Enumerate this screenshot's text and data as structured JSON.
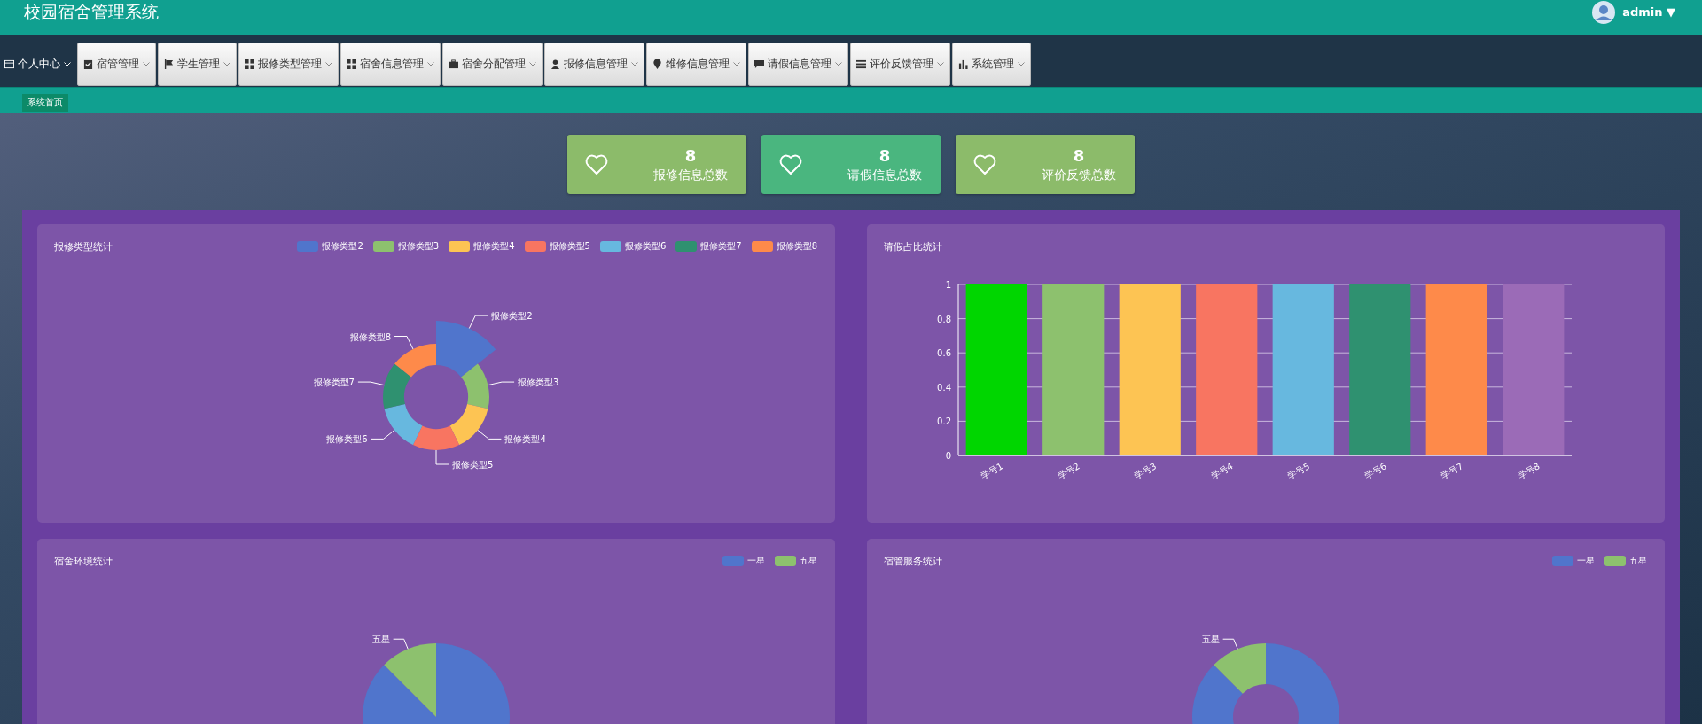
{
  "header": {
    "title": "校园宿舍管理系统",
    "user": "admin",
    "caret": "▼"
  },
  "nav": [
    {
      "label": "个人中心",
      "selected": true
    },
    {
      "label": "宿管管理",
      "selected": false
    },
    {
      "label": "学生管理",
      "selected": false
    },
    {
      "label": "报修类型管理",
      "selected": false
    },
    {
      "label": "宿舍信息管理",
      "selected": false
    },
    {
      "label": "宿舍分配管理",
      "selected": false
    },
    {
      "label": "报修信息管理",
      "selected": false
    },
    {
      "label": "维修信息管理",
      "selected": false
    },
    {
      "label": "请假信息管理",
      "selected": false
    },
    {
      "label": "评价反馈管理",
      "selected": false
    },
    {
      "label": "系统管理",
      "selected": false
    }
  ],
  "tooltip": "系统首页",
  "stats": [
    {
      "value": "8",
      "label": "报修信息总数",
      "color": "#8cbb6a"
    },
    {
      "value": "8",
      "label": "请假信息总数",
      "color": "#4ab67f"
    },
    {
      "value": "8",
      "label": "评价反馈总数",
      "color": "#8cbb6a"
    }
  ],
  "charts": [
    {
      "kind": "rose",
      "title": "报修类型统计",
      "legend": [
        {
          "label": "报修类型2",
          "color": "#5075cc"
        },
        {
          "label": "报修类型3",
          "color": "#8dc16e"
        },
        {
          "label": "报修类型4",
          "color": "#fdc453"
        },
        {
          "label": "报修类型5",
          "color": "#f87561"
        },
        {
          "label": "报修类型6",
          "color": "#67b8df"
        },
        {
          "label": "报修类型7",
          "color": "#2f9170"
        },
        {
          "label": "报修类型8",
          "color": "#fe8a4a"
        }
      ],
      "slice_labels": [
        "报修类型2",
        "报修类型3",
        "报修类型4",
        "报修类型5",
        "报修类型6",
        "报修类型7",
        "报修类型8"
      ]
    },
    {
      "kind": "bar",
      "title": "请假占比统计",
      "chart_data": {
        "type": "bar",
        "categories": [
          "学号1",
          "学号2",
          "学号3",
          "学号4",
          "学号5",
          "学号6",
          "学号7",
          "学号8"
        ],
        "series": [
          {
            "values": [
              1,
              1,
              1,
              1,
              1,
              1,
              1,
              1
            ]
          }
        ],
        "colors": [
          "#00d600",
          "#8dc16e",
          "#fdc453",
          "#f87561",
          "#67b8df",
          "#2f9170",
          "#fe8a4a",
          "#9b6bb7"
        ],
        "ylim": [
          0,
          1
        ],
        "yticks": [
          0,
          0.2,
          0.4,
          0.6,
          0.8,
          1
        ],
        "grid": true
      }
    },
    {
      "kind": "pie",
      "title": "宿舍环境统计",
      "legend": [
        {
          "label": "一星",
          "color": "#5075cc"
        },
        {
          "label": "五星",
          "color": "#8dc16e"
        }
      ],
      "slice_labels": [
        "五星"
      ]
    },
    {
      "kind": "donut",
      "title": "宿管服务统计",
      "legend": [
        {
          "label": "一星",
          "color": "#5075cc"
        },
        {
          "label": "五星",
          "color": "#8dc16e"
        }
      ],
      "slice_labels": [
        "五星"
      ]
    }
  ]
}
